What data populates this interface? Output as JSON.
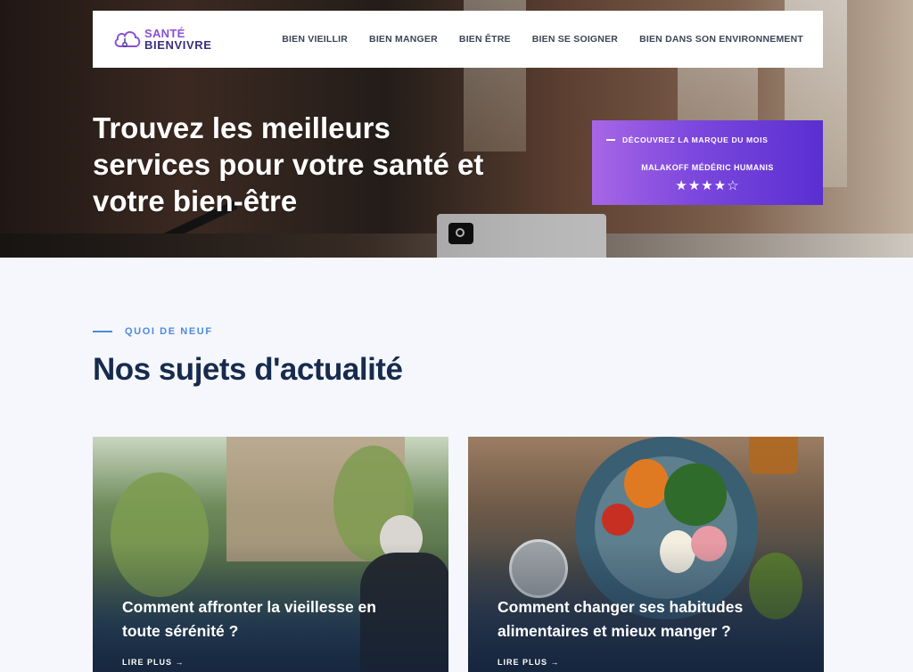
{
  "brand": {
    "line1": "SANTÉ",
    "line2": "BIENVIVRE"
  },
  "nav": {
    "items": [
      {
        "label": "BIEN VIEILLIR"
      },
      {
        "label": "BIEN MANGER"
      },
      {
        "label": "BIEN ÊTRE"
      },
      {
        "label": "BIEN SE SOIGNER"
      },
      {
        "label": "BIEN DANS SON ENVIRONNEMENT"
      }
    ]
  },
  "hero": {
    "headline": "Trouvez les meilleurs services pour votre santé et votre bien-être"
  },
  "brand_of_month": {
    "kicker": "DÉCOUVREZ LA MARQUE DU MOIS",
    "name": "MALAKOFF MÉDÉRIC HUMANIS",
    "rating": 4,
    "rating_max": 5,
    "stars": "★★★★☆"
  },
  "section": {
    "kicker": "QUOI DE NEUF",
    "title": "Nos sujets d'actualité"
  },
  "cards": [
    {
      "title": "Comment affronter la vieillesse en toute sérénité ?",
      "more": "LIRE PLUS →"
    },
    {
      "title": "Comment changer ses habitudes alimentaires et mieux manger ?",
      "more": "LIRE PLUS →"
    }
  ],
  "colors": {
    "accent_blue": "#4d8ae0",
    "title_navy": "#172b4d",
    "brand_purple": "#7b47dd",
    "background": "#f5f7fc"
  },
  "icons": {
    "logo": "cloud-stethoscope-icon",
    "arrow": "arrow-right-icon"
  }
}
